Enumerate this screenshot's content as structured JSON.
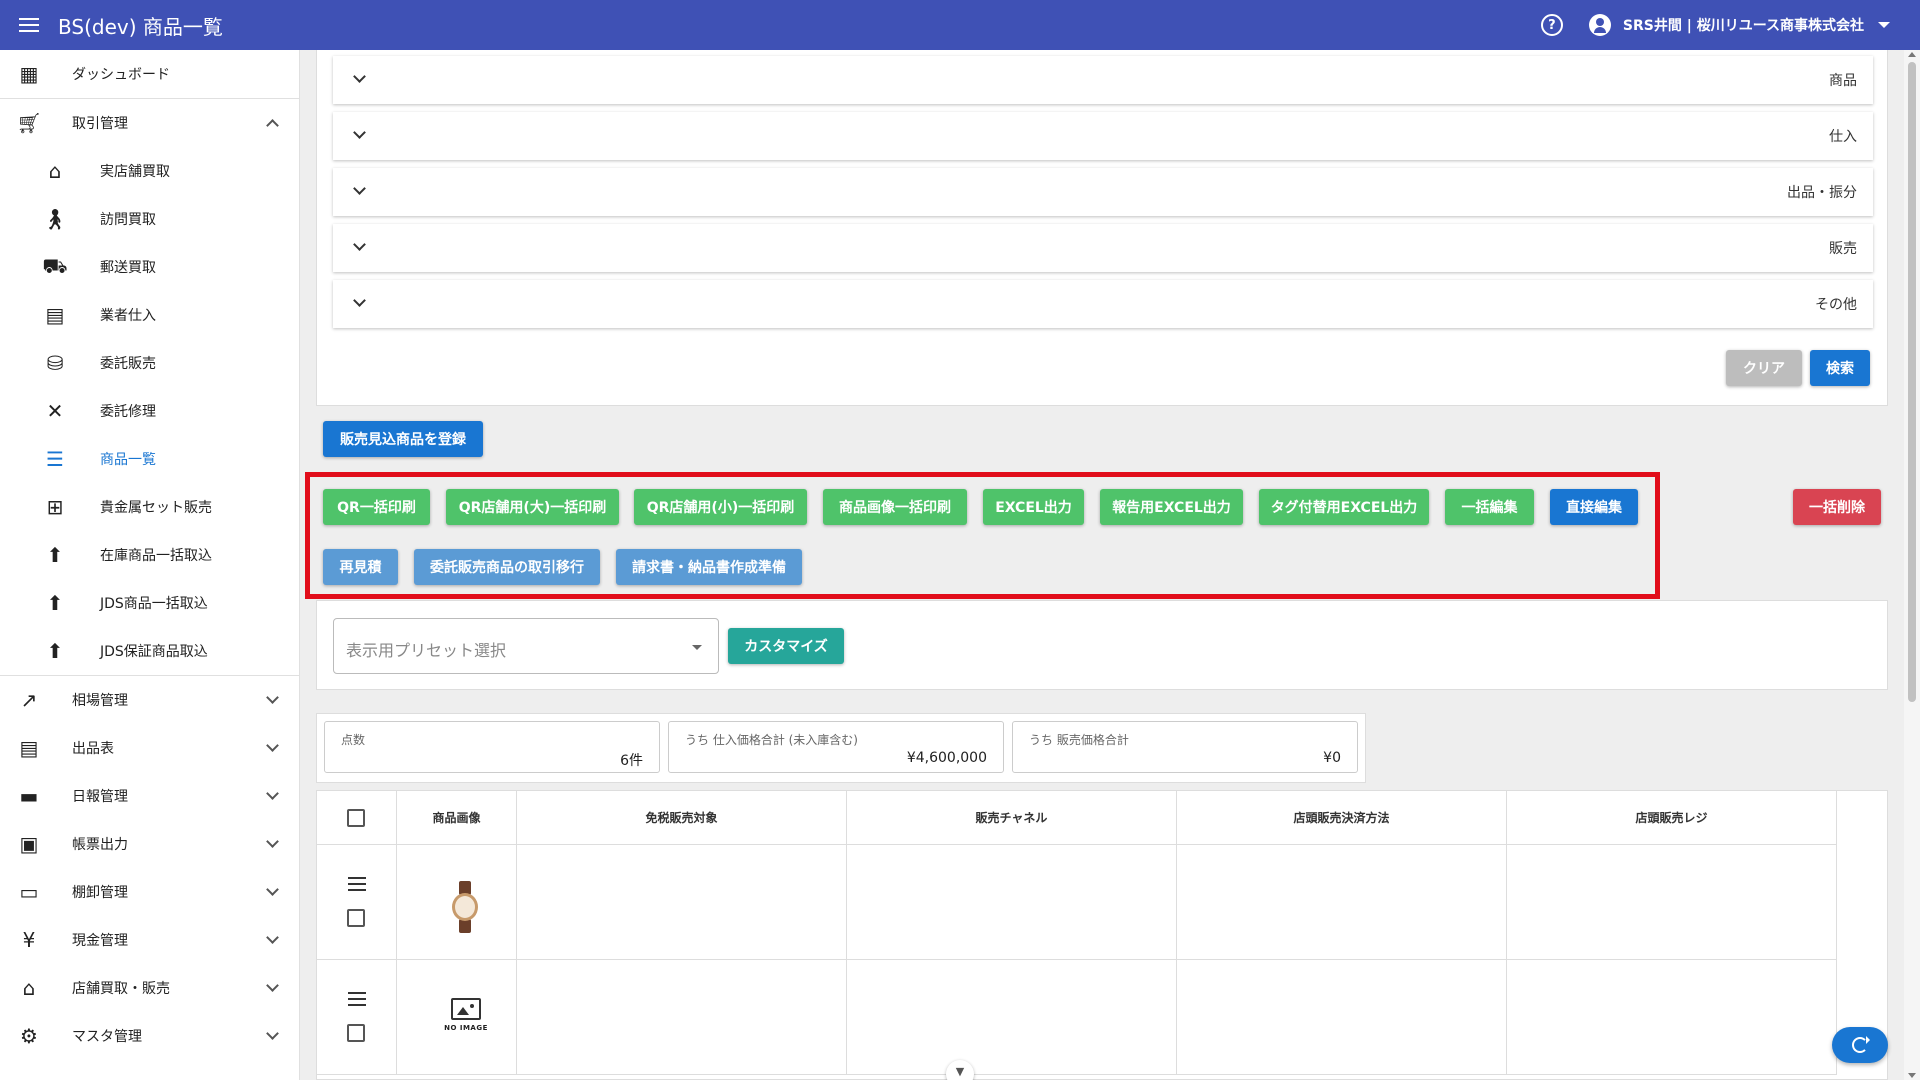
{
  "app": {
    "title": "BS(dev) 商品一覧",
    "account": "SRS井間 | 桜川リユース商事株式会社"
  },
  "sidebar": {
    "items": [
      {
        "label": "ダッシュボード",
        "icon": "dashboard-icon"
      },
      {
        "label": "取引管理",
        "icon": "cart-icon",
        "expanded": true
      },
      {
        "label": "実店舗買取",
        "icon": "store-icon"
      },
      {
        "label": "訪問買取",
        "icon": "walk-icon"
      },
      {
        "label": "郵送買取",
        "icon": "truck-icon"
      },
      {
        "label": "業者仕入",
        "icon": "business-icon"
      },
      {
        "label": "委託販売",
        "icon": "consign-icon"
      },
      {
        "label": "委託修理",
        "icon": "tools-icon"
      },
      {
        "label": "商品一覧",
        "icon": "list-icon",
        "active": true
      },
      {
        "label": "貴金属セット販売",
        "icon": "grid-icon"
      },
      {
        "label": "在庫商品一括取込",
        "icon": "upload-icon"
      },
      {
        "label": "JDS商品一括取込",
        "icon": "upload-icon"
      },
      {
        "label": "JDS保証商品取込",
        "icon": "upload-icon"
      },
      {
        "label": "相場管理",
        "icon": "trend-icon"
      },
      {
        "label": "出品表",
        "icon": "listsheet-icon"
      },
      {
        "label": "日報管理",
        "icon": "document-icon"
      },
      {
        "label": "帳票出力",
        "icon": "note-icon"
      },
      {
        "label": "棚卸管理",
        "icon": "archive-icon"
      },
      {
        "label": "現金管理",
        "icon": "yen-icon"
      },
      {
        "label": "店舗買取・販売",
        "icon": "store-icon"
      },
      {
        "label": "マスタ管理",
        "icon": "gear-icon"
      }
    ]
  },
  "filters": {
    "sections": [
      "商品",
      "仕入",
      "出品・振分",
      "販売",
      "その他"
    ],
    "clear_label": "クリア",
    "search_label": "検索"
  },
  "actions": {
    "register_label": "販売見込商品を登録",
    "row1": [
      "QR一括印刷",
      "QR店舗用(大)一括印刷",
      "QR店舗用(小)一括印刷",
      "商品画像一括印刷",
      "EXCEL出力",
      "報告用EXCEL出力",
      "タグ付替用EXCEL出力",
      "一括編集",
      "直接編集"
    ],
    "row2": [
      "再見積",
      "委託販売商品の取引移行",
      "請求書・納品書作成準備"
    ],
    "delete_label": "一括削除"
  },
  "preset": {
    "placeholder": "表示用プリセット選択",
    "customize_label": "カスタマイズ"
  },
  "summary": [
    {
      "label": "点数",
      "value": "6件"
    },
    {
      "label": "うち 仕入価格合計 (未入庫含む)",
      "value": "¥4,600,000"
    },
    {
      "label": "うち 販売価格合計",
      "value": "¥0"
    }
  ],
  "table": {
    "columns": [
      "商品画像",
      "免税販売対象",
      "販売チャネル",
      "店頭販売決済方法",
      "店頭販売レジ"
    ],
    "no_image_text": "NO IMAGE"
  },
  "colors": {
    "primary": "#3f51b5",
    "green": "#4fc36a",
    "blue": "#1976d2",
    "red": "#d94452",
    "highlight": "#e10d1a"
  }
}
